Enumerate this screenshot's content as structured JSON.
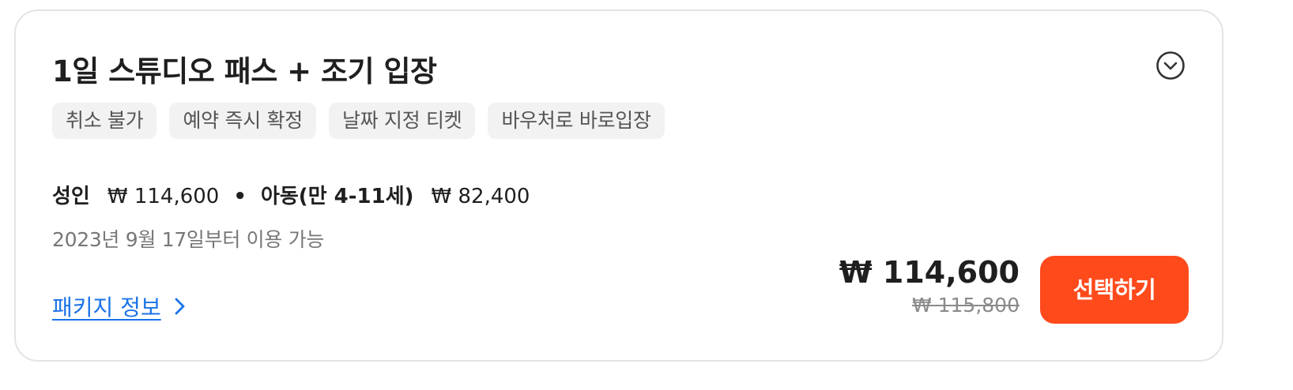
{
  "product": {
    "title": "1일 스튜디오 패스 + 조기 입장",
    "expand_icon": "chevron-down-circle-icon"
  },
  "tags": [
    "취소 불가",
    "예약 즉시 확정",
    "날짜 지정 티켓",
    "바우처로 바로입장"
  ],
  "pricing": {
    "adult_label": "성인",
    "adult_price": "₩ 114,600",
    "separator": "•",
    "child_label": "아동(만 4-11세)",
    "child_price": "₩ 82,400",
    "availability": "2023년 9월 17일부터 이용 가능",
    "current_price": "₩ 114,600",
    "original_price": "₩ 115,800"
  },
  "actions": {
    "package_info_label": "패키지 정보",
    "select_label": "선택하기"
  },
  "colors": {
    "accent": "#ff4a1c",
    "link": "#1a73e8",
    "tag_bg": "#f2f2f2"
  }
}
